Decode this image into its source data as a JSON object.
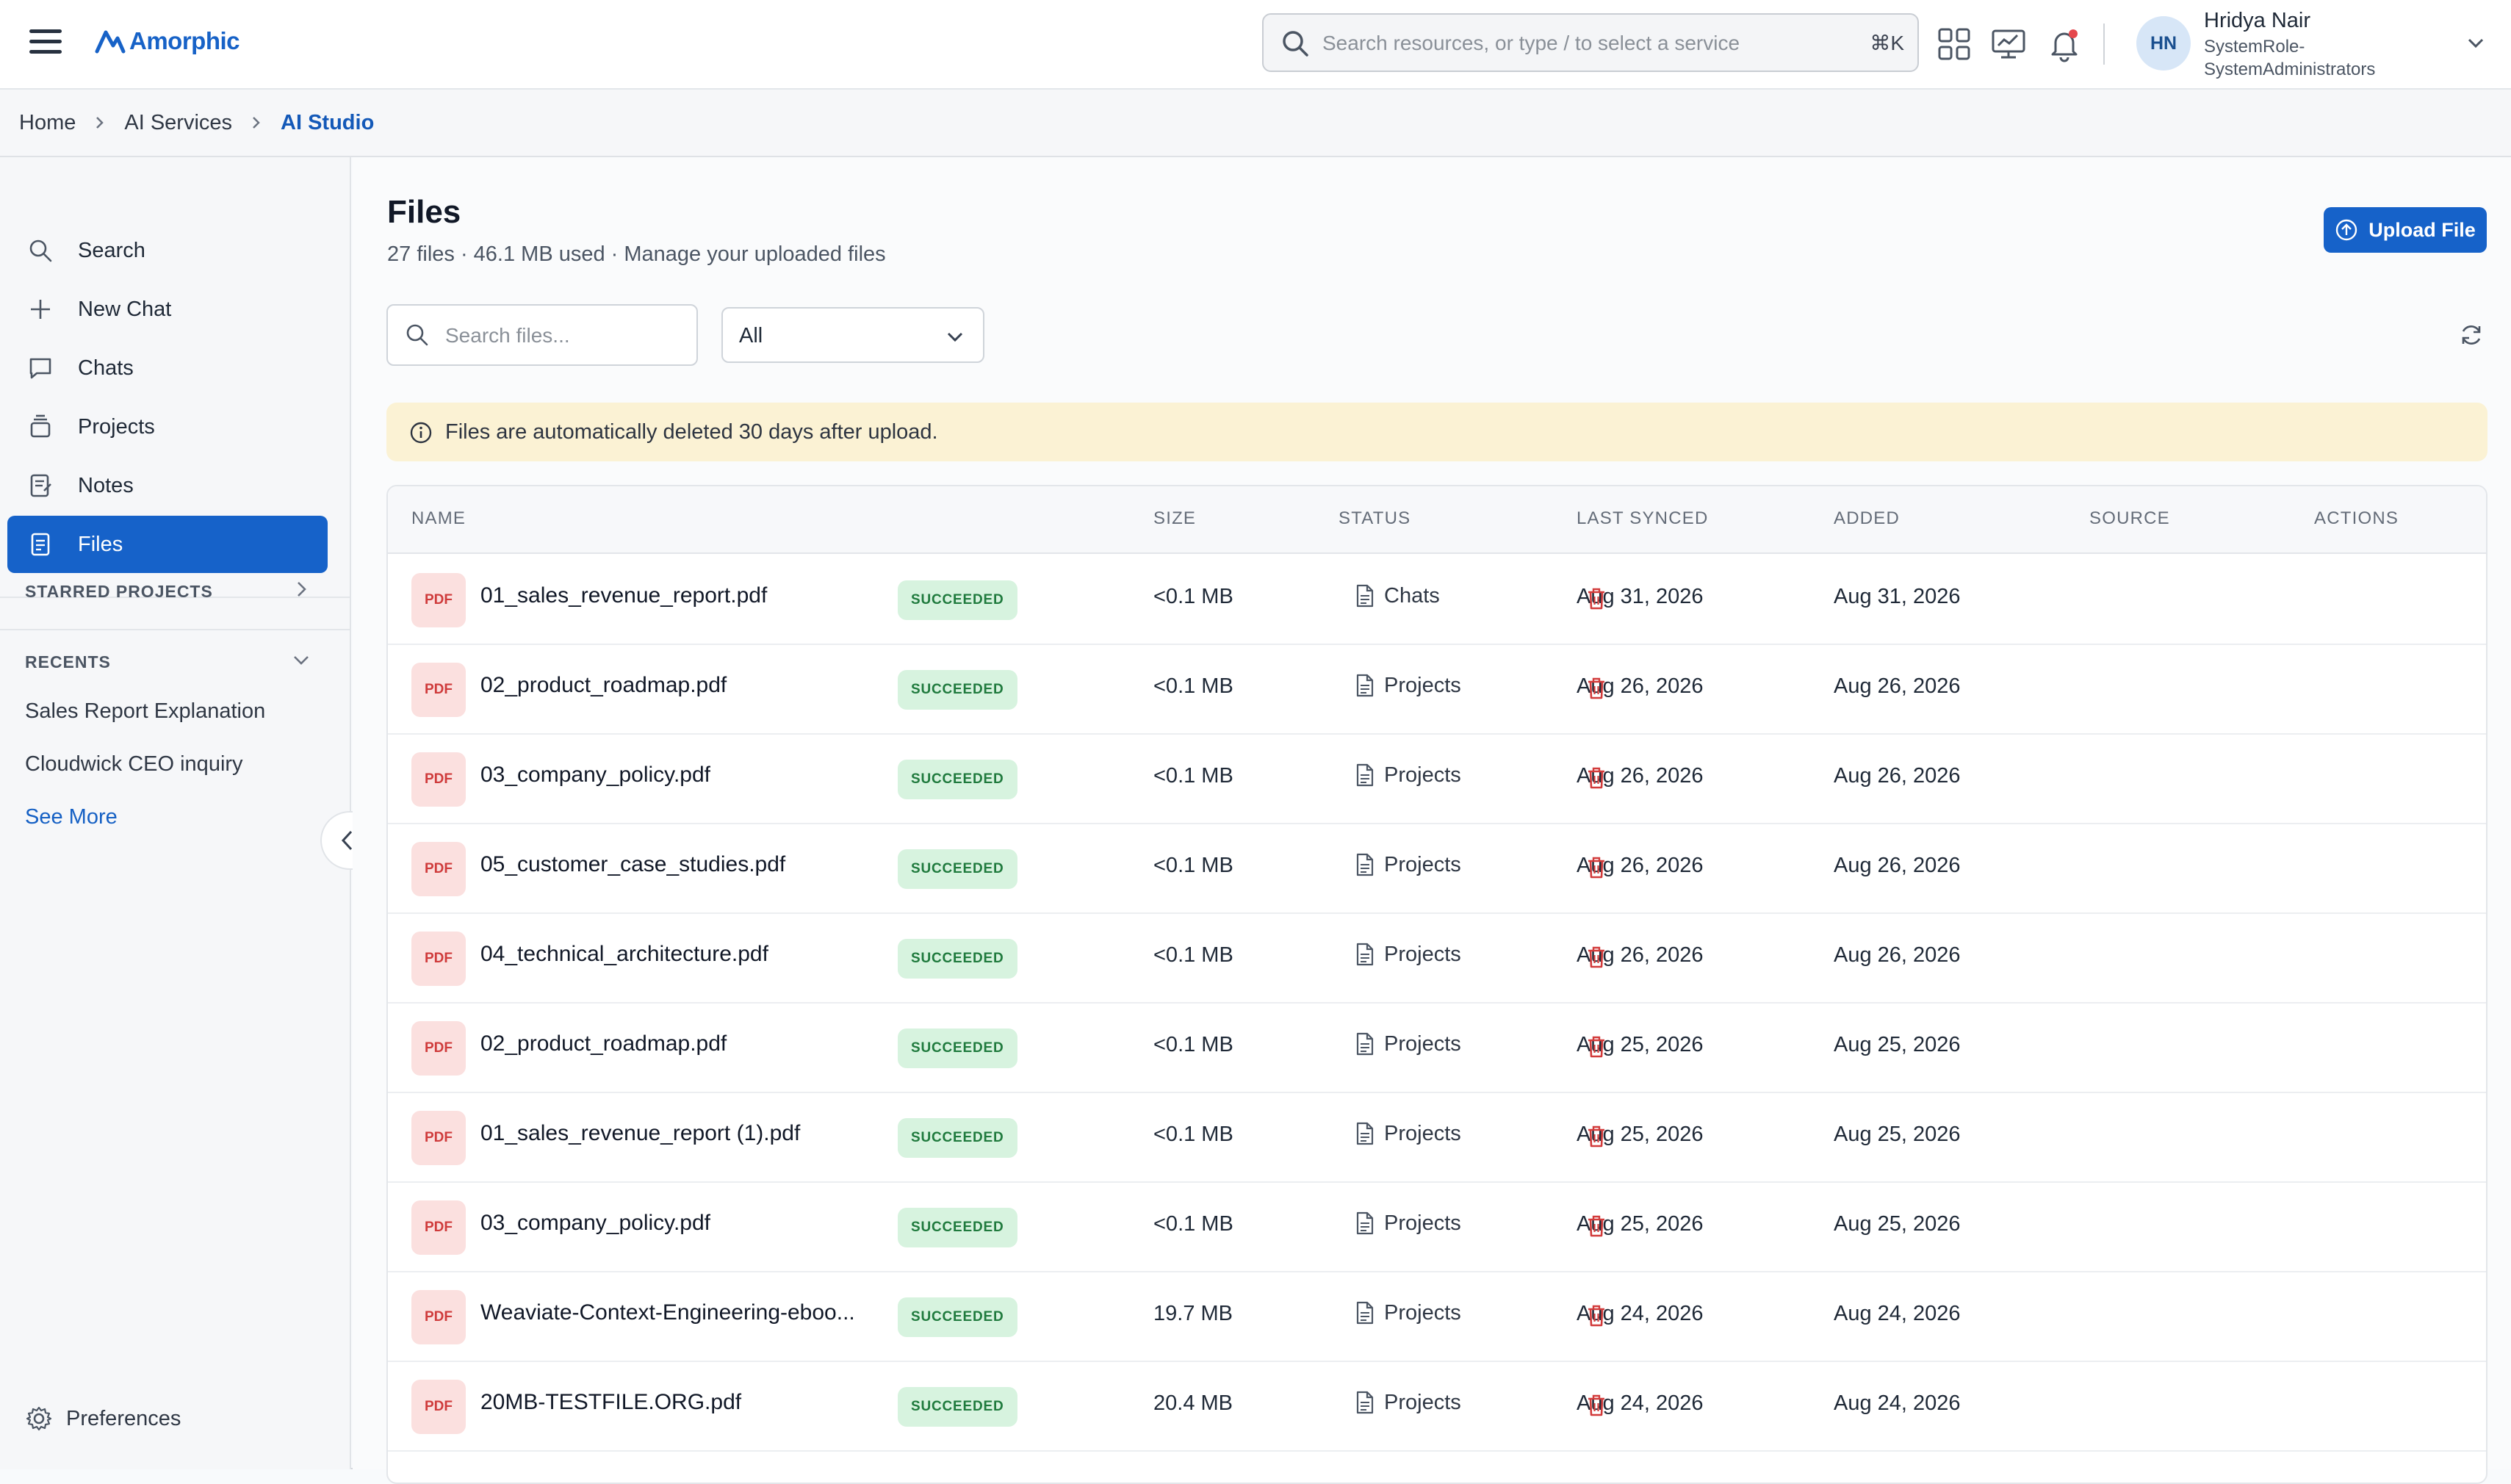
{
  "app": {
    "name": "Amorphic"
  },
  "topbar": {
    "search_placeholder": "Search resources, or type / to select a service",
    "shortcut": "⌘K",
    "user": {
      "initials": "HN",
      "name": "Hridya Nair",
      "role": "SystemRole-SystemAdministrators"
    }
  },
  "breadcrumb": [
    "Home",
    "AI Services",
    "AI Studio"
  ],
  "sidebar": {
    "items": [
      {
        "label": "Search",
        "icon": "search-icon"
      },
      {
        "label": "New Chat",
        "icon": "plus-icon"
      },
      {
        "label": "Chats",
        "icon": "chat-bubble-icon"
      },
      {
        "label": "Projects",
        "icon": "stack-icon"
      },
      {
        "label": "Notes",
        "icon": "notes-icon"
      },
      {
        "label": "Files",
        "icon": "file-icon",
        "active": true
      }
    ],
    "starred_label": "STARRED PROJECTS",
    "recents_label": "RECENTS",
    "recents": [
      "Sales Report Explanation",
      "Cloudwick CEO inquiry"
    ],
    "see_more": "See More",
    "preferences": "Preferences"
  },
  "page": {
    "title": "Files",
    "subtitle": "27 files · 46.1 MB used · Manage your uploaded files",
    "upload_label": "Upload File",
    "search_placeholder": "Search files...",
    "filter_value": "All",
    "notice": "Files are automatically deleted 30 days after upload."
  },
  "table": {
    "columns": [
      "NAME",
      "SIZE",
      "STATUS",
      "LAST SYNCED",
      "ADDED",
      "SOURCE",
      "ACTIONS"
    ],
    "badge": "PDF",
    "rows": [
      {
        "name": "01_sales_revenue_report.pdf",
        "size": "<0.1 MB",
        "status": "SUCCEEDED",
        "synced": "Aug 31, 2026",
        "added": "Aug 31, 2026",
        "source": "Chats"
      },
      {
        "name": "02_product_roadmap.pdf",
        "size": "<0.1 MB",
        "status": "SUCCEEDED",
        "synced": "Aug 26, 2026",
        "added": "Aug 26, 2026",
        "source": "Projects"
      },
      {
        "name": "03_company_policy.pdf",
        "size": "<0.1 MB",
        "status": "SUCCEEDED",
        "synced": "Aug 26, 2026",
        "added": "Aug 26, 2026",
        "source": "Projects"
      },
      {
        "name": "05_customer_case_studies.pdf",
        "size": "<0.1 MB",
        "status": "SUCCEEDED",
        "synced": "Aug 26, 2026",
        "added": "Aug 26, 2026",
        "source": "Projects"
      },
      {
        "name": "04_technical_architecture.pdf",
        "size": "<0.1 MB",
        "status": "SUCCEEDED",
        "synced": "Aug 26, 2026",
        "added": "Aug 26, 2026",
        "source": "Projects"
      },
      {
        "name": "02_product_roadmap.pdf",
        "size": "<0.1 MB",
        "status": "SUCCEEDED",
        "synced": "Aug 25, 2026",
        "added": "Aug 25, 2026",
        "source": "Projects"
      },
      {
        "name": "01_sales_revenue_report (1).pdf",
        "size": "<0.1 MB",
        "status": "SUCCEEDED",
        "synced": "Aug 25, 2026",
        "added": "Aug 25, 2026",
        "source": "Projects"
      },
      {
        "name": "03_company_policy.pdf",
        "size": "<0.1 MB",
        "status": "SUCCEEDED",
        "synced": "Aug 25, 2026",
        "added": "Aug 25, 2026",
        "source": "Projects"
      },
      {
        "name": "Weaviate-Context-Engineering-eboo...",
        "size": "19.7 MB",
        "status": "SUCCEEDED",
        "synced": "Aug 24, 2026",
        "added": "Aug 24, 2026",
        "source": "Projects"
      },
      {
        "name": "20MB-TESTFILE.ORG.pdf",
        "size": "20.4 MB",
        "status": "SUCCEEDED",
        "synced": "Aug 24, 2026",
        "added": "Aug 24, 2026",
        "source": "Projects"
      }
    ]
  },
  "colors": {
    "accent": "#1662c9",
    "success_bg": "#d7f3df",
    "success_fg": "#1f7a3d",
    "pdf_bg": "#fbe0df",
    "pdf_fg": "#cf3b3b",
    "notice_bg": "#fbf2d4",
    "delete": "#d23b3b"
  }
}
